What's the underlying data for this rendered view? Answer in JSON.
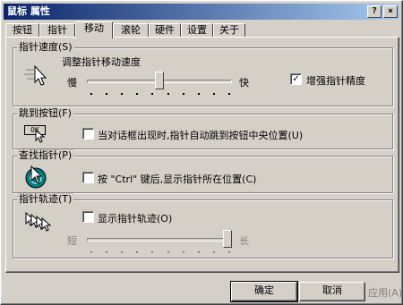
{
  "window": {
    "title": "鼠标 属性",
    "help_symbol": "?",
    "close_symbol": "×"
  },
  "tabs": [
    {
      "label": "按钮"
    },
    {
      "label": "指针"
    },
    {
      "label": "移动"
    },
    {
      "label": "滚轮"
    },
    {
      "label": "硬件"
    },
    {
      "label": "设置"
    },
    {
      "label": "关于"
    }
  ],
  "active_tab": "移动",
  "speed": {
    "legend": "指针速度(S)",
    "subtitle": "调整指针移动速度",
    "slow_label": "慢",
    "fast_label": "快",
    "level_fraction": 0.5,
    "enhance_label": "增强指针精度",
    "enhance_checked": true
  },
  "snap": {
    "legend": "跳到按钮(F)",
    "icon_text": "OK",
    "checkbox_label": "当对话框出现时,指针自动跳到按钮中央位置(U)",
    "checked": false
  },
  "locate": {
    "legend": "查找指针(P)",
    "checkbox_label": "按 \"Ctrl\" 键后,显示指针所在位置(C)",
    "checked": false
  },
  "trails": {
    "legend": "指针轨迹(T)",
    "checkbox_label": "显示指针轨迹(O)",
    "checked": false,
    "short_label": "短",
    "long_label": "长",
    "level_fraction": 1.0
  },
  "buttons": {
    "ok": "确定",
    "cancel": "取消",
    "apply": "应用(A)"
  },
  "icons": {
    "speed": "pointer-speed-icon",
    "snap": "ok-button-cursor-icon",
    "locate": "locate-pointer-icon",
    "trails": "pointer-trails-icon"
  },
  "colors": {
    "title_start": "#0a246a",
    "title_end": "#a6caf0",
    "face": "#d4d0c8"
  }
}
